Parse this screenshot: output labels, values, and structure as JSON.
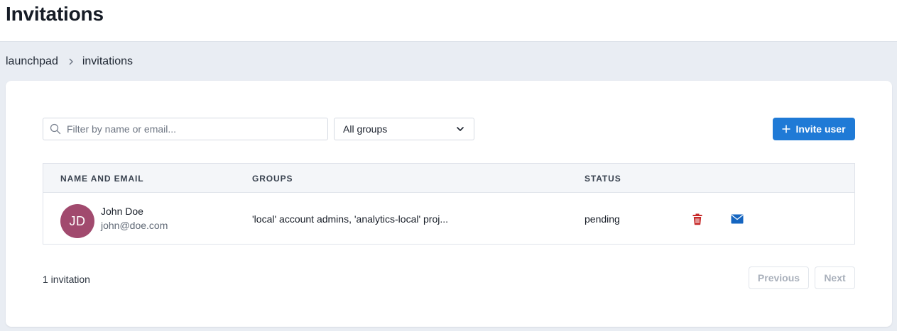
{
  "header": {
    "title": "Invitations"
  },
  "breadcrumb": {
    "items": [
      "launchpad",
      "invitations"
    ]
  },
  "filters": {
    "search_placeholder": "Filter by name or email...",
    "search_value": "",
    "group_select": "All groups"
  },
  "actions": {
    "invite_label": "Invite user"
  },
  "table": {
    "columns": [
      "NAME AND EMAIL",
      "GROUPS",
      "STATUS"
    ],
    "rows": [
      {
        "initials": "JD",
        "name": "John Doe",
        "email": "john@doe.com",
        "groups": "'local' account admins, 'analytics-local' proj...",
        "status": "pending",
        "avatar_color": "#a14a6e"
      }
    ]
  },
  "footer": {
    "count": "1 invitation",
    "previous_label": "Previous",
    "next_label": "Next"
  },
  "colors": {
    "accent": "#1f7ad6",
    "delete_icon": "#c62828",
    "mail_icon": "#1565c0"
  },
  "icons": {
    "search": "search-icon",
    "dropdown": "chevron-down-icon",
    "invite": "plus-icon",
    "breadcrumb_separator": "chevron-right-icon",
    "delete": "trash-icon",
    "resend": "mail-icon"
  }
}
